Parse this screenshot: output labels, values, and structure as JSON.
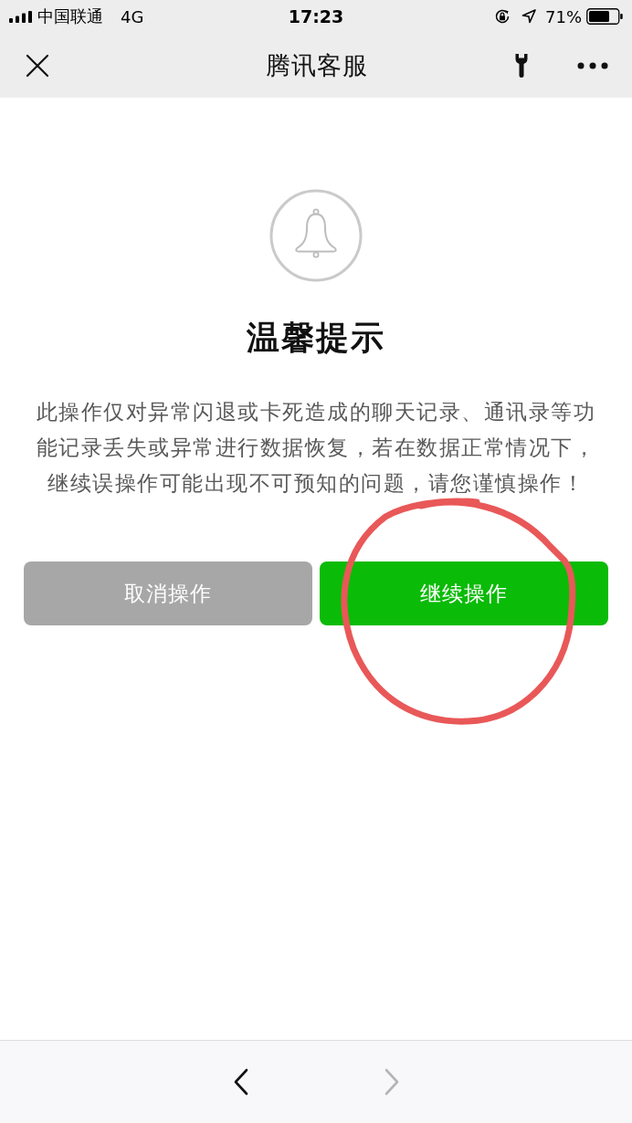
{
  "status_bar": {
    "carrier": "中国联通",
    "network": "4G",
    "time": "17:23",
    "battery": "71%"
  },
  "nav_bar": {
    "title": "腾讯客服"
  },
  "notice": {
    "title": "温馨提示",
    "message": "此操作仅对异常闪退或卡死造成的聊天记录、通讯录等功能记录丢失或异常进行数据恢复，若在数据正常情况下，继续误操作可能出现不可预知的问题，请您谨慎操作！"
  },
  "buttons": [
    {
      "label": "取消操作",
      "kind": "secondary"
    },
    {
      "label": "继续操作",
      "kind": "primary"
    }
  ],
  "toolbar": [
    {
      "kind": "back",
      "disabled": false
    },
    {
      "kind": "forward",
      "disabled": true
    }
  ]
}
